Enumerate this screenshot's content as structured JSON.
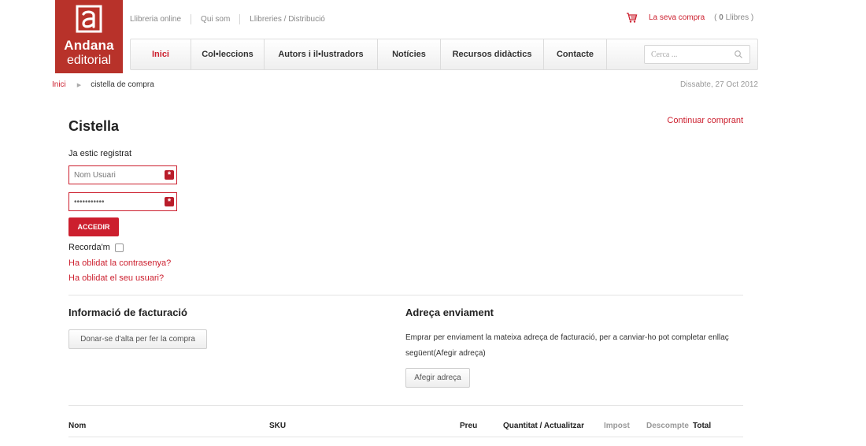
{
  "brand": {
    "name": "Andana",
    "sub": "editorial",
    "color": "#b8322a",
    "mark_icon": "a-letter-icon"
  },
  "top_links": [
    "Llibreria online",
    "Qui som",
    "Llibreries / Distribució"
  ],
  "cart": {
    "label": "La seva compra",
    "count_prefix": "( ",
    "count": "0",
    "count_suffix": " Llibres )",
    "icon": "cart-icon"
  },
  "nav": {
    "items": [
      "Inici",
      "Col•leccions",
      "Autors i il•lustradors",
      "Notícies",
      "Recursos didàctics",
      "Contacte"
    ],
    "active_index": 0,
    "search_placeholder": "Cerca ..."
  },
  "breadcrumb": {
    "home": "Inici",
    "current": "cistella de compra"
  },
  "date": "Dissabte, 27 Oct 2012",
  "page": {
    "title": "Cistella",
    "continue_link": "Continuar comprant"
  },
  "login": {
    "heading": "Ja estic registrat",
    "username_placeholder": "Nom Usuari",
    "password_value": "•••••••••••",
    "submit_label": "ACCEDIR",
    "remember_label": "Recorda'm",
    "forgot_password": "Ha oblidat la contrasenya?",
    "forgot_username": "Ha oblidat el seu usuari?"
  },
  "billing": {
    "title": "Informació de facturació",
    "button": "Donar-se d'alta per fer la compra"
  },
  "shipping": {
    "title": "Adreça enviament",
    "text": "Emprar per enviament la mateixa adreça de facturació, per a canviar-ho pot completar enllaç següent(Afegir adreça)",
    "button": "Afegir adreça"
  },
  "table": {
    "columns": [
      "Nom",
      "SKU",
      "Preu",
      "Quantitat / Actualitzar",
      "Impost",
      "Descompte",
      "Total"
    ]
  },
  "colors": {
    "accent": "#cc1f2e",
    "text": "#333333",
    "muted": "#999999"
  }
}
